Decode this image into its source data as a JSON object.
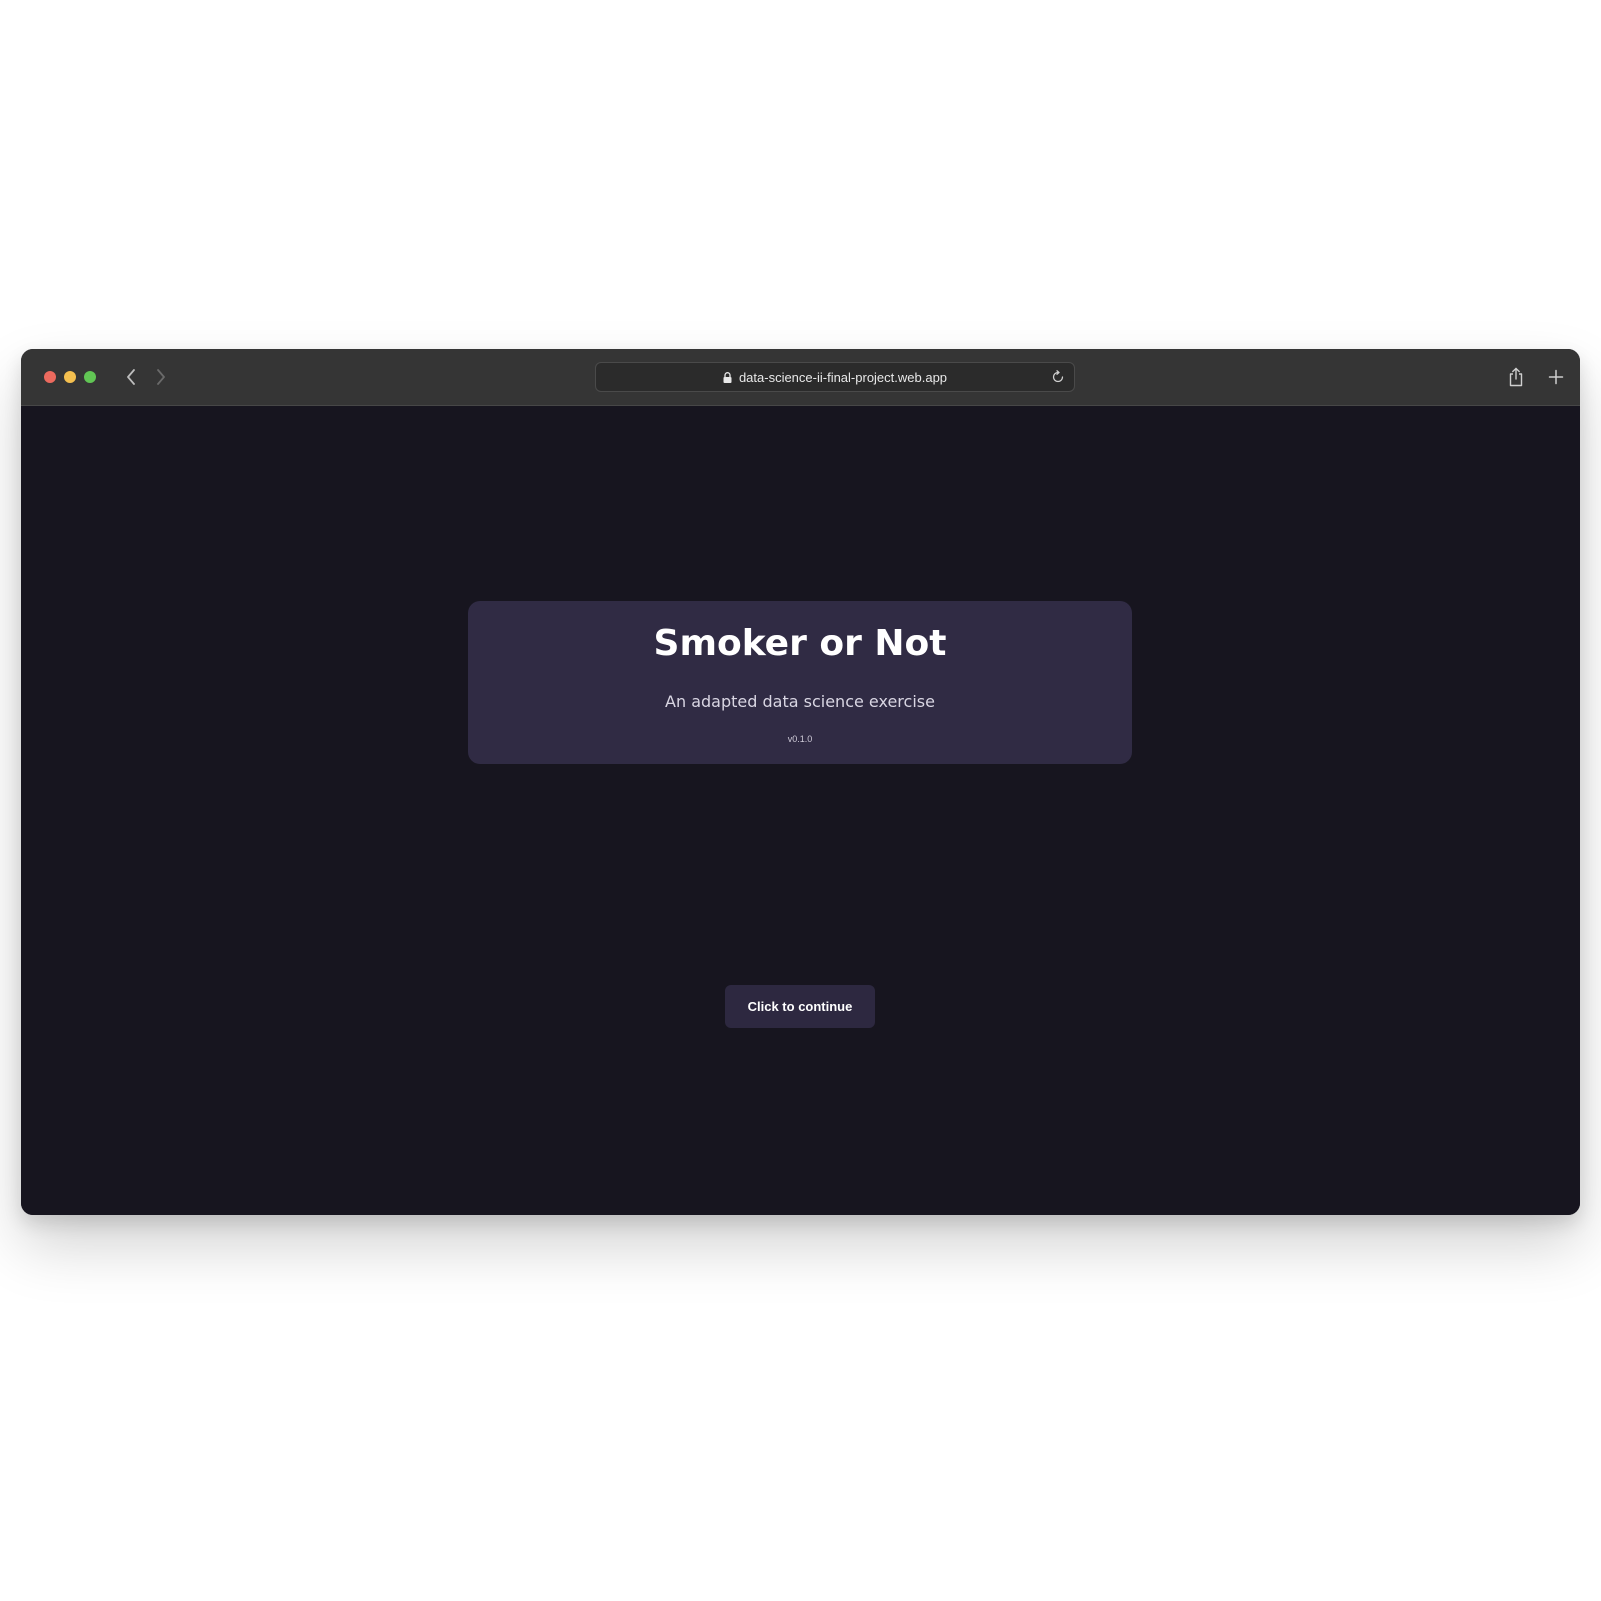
{
  "browser": {
    "url": "data-science-ii-final-project.web.app",
    "icons": {
      "back": "chevron-left-icon",
      "forward": "chevron-right-icon",
      "lock": "lock-icon",
      "reload": "reload-icon",
      "share": "share-icon",
      "new_tab": "plus-icon"
    }
  },
  "card": {
    "title": "Smoker or Not",
    "subtitle": "An adapted data science exercise",
    "version": "v0.1.0"
  },
  "continue_button": {
    "label": "Click to continue"
  },
  "colors": {
    "page_background": "#17151f",
    "card_background": "#302b44",
    "button_background": "#2d2840",
    "titlebar": "#353535"
  }
}
